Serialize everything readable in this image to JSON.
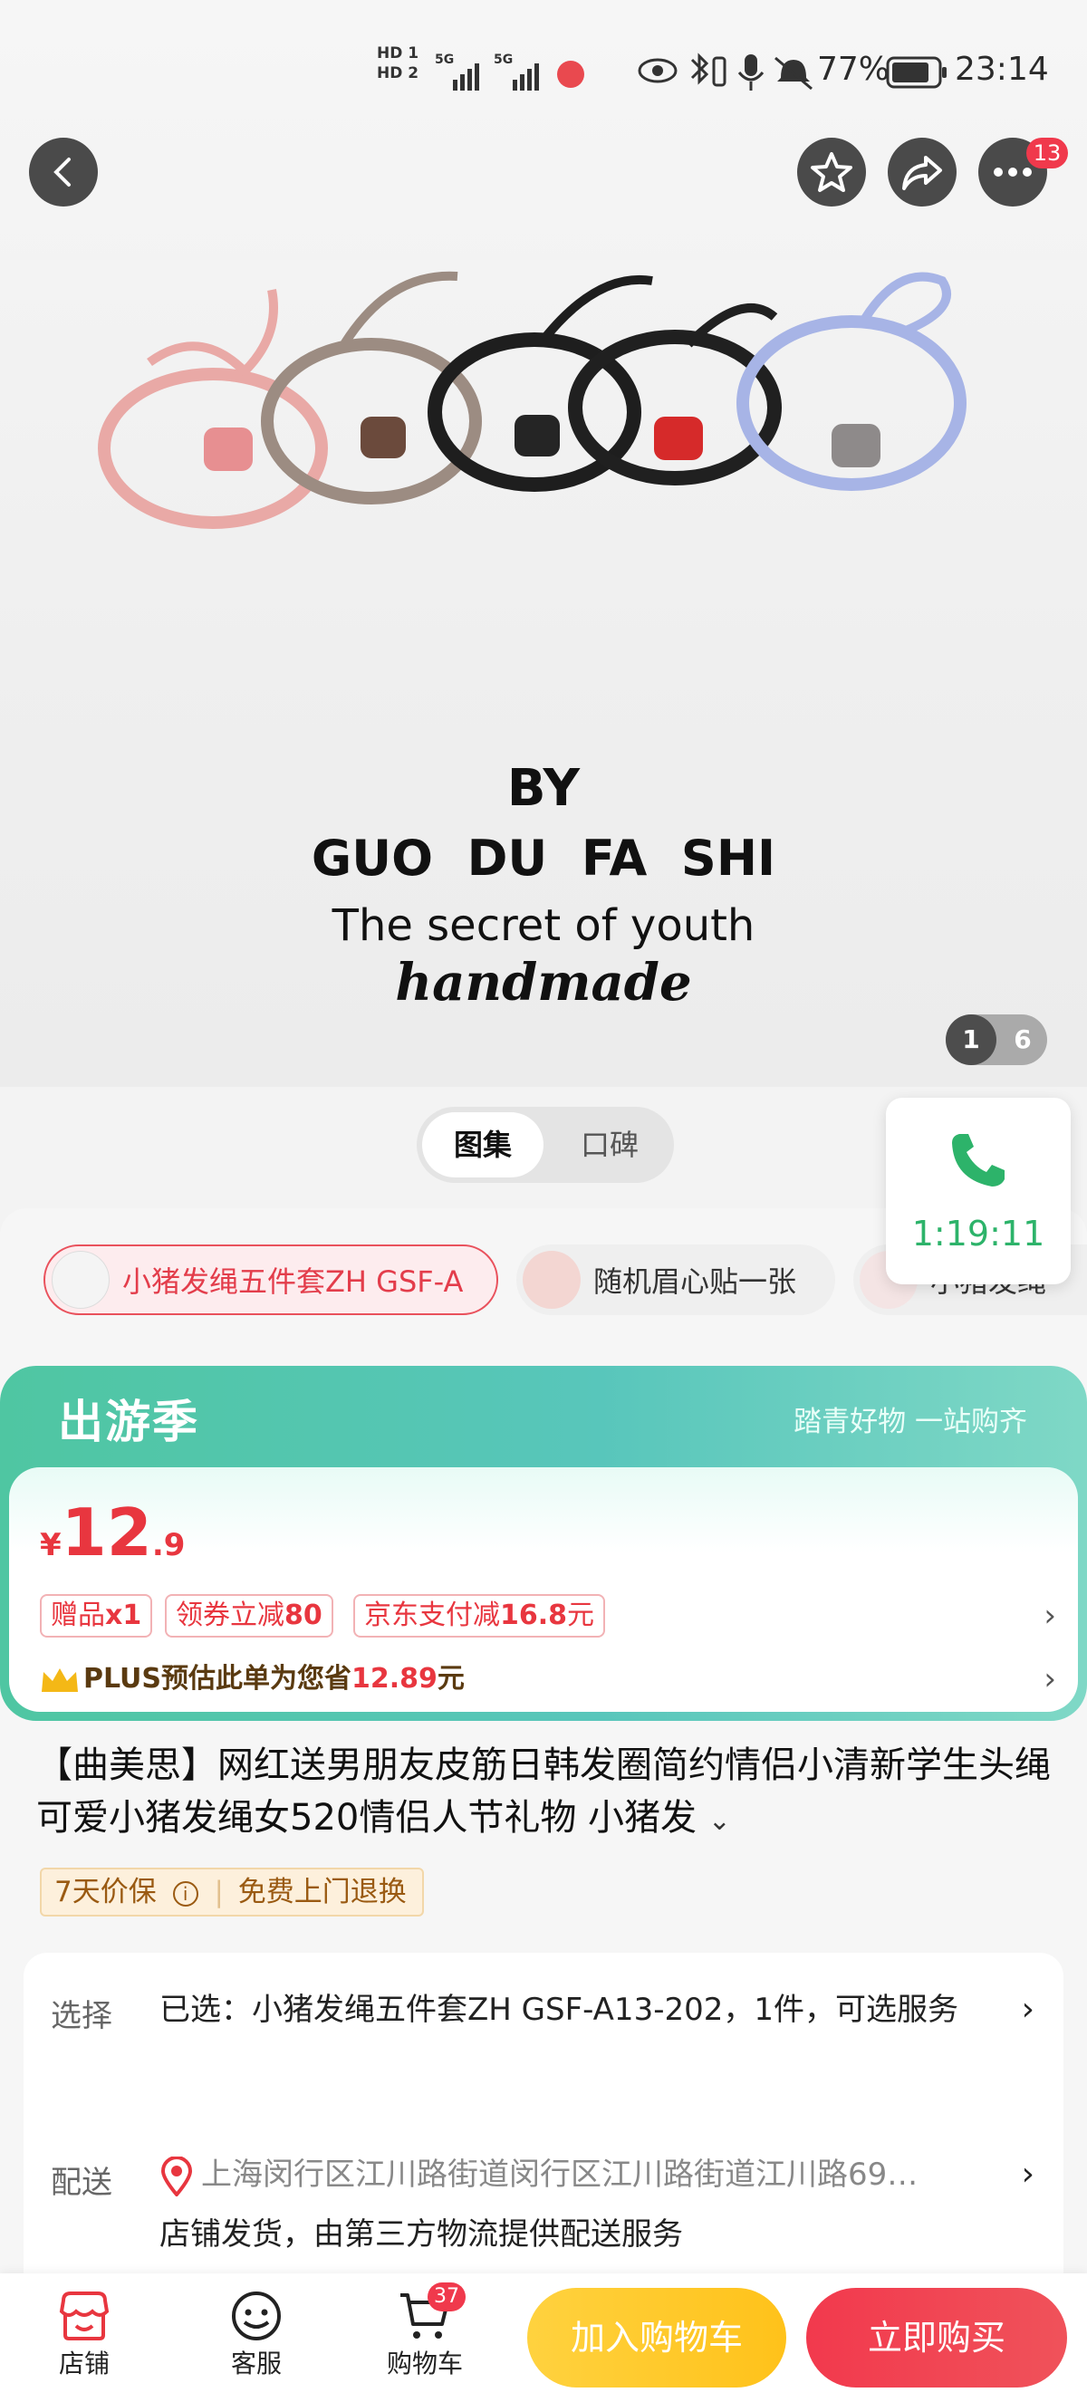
{
  "status_bar": {
    "battery": "77%",
    "time": "23:14",
    "sim1": "HD 1",
    "sim2": "HD 2",
    "net1": "5G",
    "net2": "5G"
  },
  "gallery": {
    "line1": "BY",
    "line2": "GUO  DU  FA  SHI",
    "line3": "The secret of youth",
    "line4": "handmade",
    "current": "1",
    "total": "6",
    "notif_badge": "13"
  },
  "tabs": [
    {
      "label": "图集",
      "active": true
    },
    {
      "label": "口碑",
      "active": false
    }
  ],
  "call_widget": {
    "time": "1:19:11"
  },
  "variants": [
    {
      "label": "小猪发绳五件套ZH GSF-A",
      "selected": true
    },
    {
      "label": "随机眉心贴一张",
      "selected": false
    },
    {
      "label": "小猪发绳",
      "selected": false
    }
  ],
  "promo": {
    "title": "出游季",
    "subtitle": "踏青好物 一站购齐",
    "price_symbol": "¥",
    "price_int": "12",
    "price_dec": ".9",
    "tags": [
      {
        "prefix": "赠品",
        "bold": "x1"
      },
      {
        "prefix": "领券立减",
        "bold": "80"
      },
      {
        "prefix": "京东支付减",
        "bold": "16.8",
        "suffix": "元"
      }
    ],
    "plus_prefix": "PLUS预估此单为您省",
    "plus_amount": "12.89",
    "plus_suffix": "元"
  },
  "product": {
    "title": "【曲美思】网红送男朋友皮筋日韩发圈简约情侣小清新学生头绳可爱小猪发绳女520情侣人节礼物 小猪发",
    "guarantee_1": "7天价保",
    "guarantee_2": "免费上门退换"
  },
  "options": {
    "select_label": "选择",
    "select_value": "已选：小猪发绳五件套ZH GSF-A13-202，1件，可选服务",
    "delivery_label": "配送",
    "delivery_address": "上海闵行区江川路街道闵行区江川路街道江川路69…",
    "delivery_note": "店铺发货，由第三方物流提供配送服务"
  },
  "bottom_bar": {
    "shop": "店铺",
    "service": "客服",
    "cart": "购物车",
    "cart_count": "37",
    "add_to_cart": "加入购物车",
    "buy_now": "立即购买"
  },
  "colors": {
    "accent_red": "#e8363f",
    "promo_green": "#4fc6a2",
    "add_yellow": "#ffc21a",
    "call_green": "#2db36a"
  }
}
